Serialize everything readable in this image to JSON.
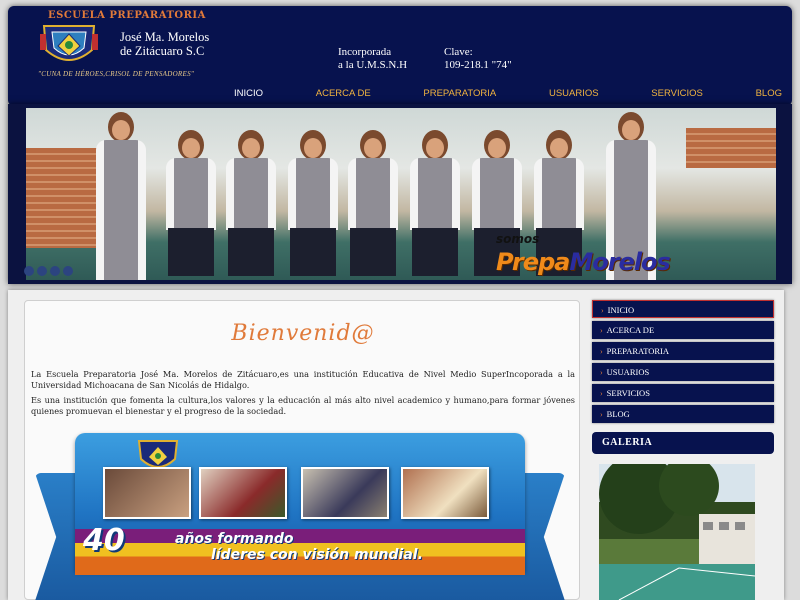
{
  "header": {
    "school_line": "ESCUELA PREPARATORIA",
    "name_line1": "José Ma. Morelos",
    "name_line2": "de Zitácuaro S.C",
    "motto": "\"CUNA DE HÉROES,CRISOL DE PENSADORES\"",
    "incorp_line1": "Incorporada",
    "incorp_line2": "a la U.M.S.N.H",
    "clave_line1": "Clave:",
    "clave_line2": "109-218.1 \"74\""
  },
  "top_nav": [
    {
      "label": "INICIO"
    },
    {
      "label": "ACERCA DE"
    },
    {
      "label": "PREPARATORIA"
    },
    {
      "label": "USUARIOS"
    },
    {
      "label": "SERVICIOS"
    },
    {
      "label": "BLOG"
    }
  ],
  "banner": {
    "somos": "somos",
    "logo_part1": "Prepa",
    "logo_part2": "Morelos"
  },
  "main": {
    "welcome": "Bienvenid@",
    "para1": "La Escuela Preparatoria José Ma. Morelos de Zitácuaro,es una institución Educativa de Nivel Medio SuperIncoporada a la Universidad Michoacana de San Nicolás de Hidalgo.",
    "para2": "Es una institución que fomenta la cultura,los valores y la educación al más alto nivel academico y humano,para formar jóvenes quienes promuevan el bienestar y el progreso de la sociedad.",
    "promo_number": "40",
    "promo_line1": "años formando",
    "promo_line2": "líderes con visión mundial."
  },
  "sidebar": {
    "items": [
      {
        "label": "INICIO"
      },
      {
        "label": "ACERCA DE"
      },
      {
        "label": "PREPARATORIA"
      },
      {
        "label": "USUARIOS"
      },
      {
        "label": "SERVICIOS"
      },
      {
        "label": "BLOG"
      }
    ],
    "galeria_title": "GALERIA"
  },
  "colors": {
    "navy": "#07124e",
    "orange_accent": "#e07a3a",
    "nav_gold": "#f0b340"
  }
}
